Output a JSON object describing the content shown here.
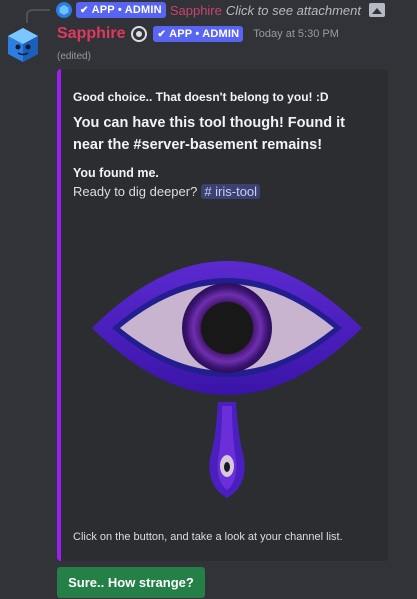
{
  "reply": {
    "badge_label": "APP • ADMIN",
    "author": "Sapphire",
    "text": "Click to see attachment",
    "icon": "image-icon"
  },
  "message": {
    "author": "Sapphire",
    "badge_label": "APP • ADMIN",
    "timestamp": "Today at 5:30 PM",
    "edited": "(edited)",
    "author_color": "#e0395e"
  },
  "embed": {
    "accent_color": "#9b1ff2",
    "line1": "Good choice.. That doesn't belong to you! :D",
    "line2": "You can have this tool though! Found it near the #server-basement remains!",
    "line3": "You found me.",
    "line4_prefix": "Ready to dig deeper?",
    "channel_mention": "# iris-tool",
    "footer": "Click on the button, and take a look at your channel list."
  },
  "button": {
    "label": "Sure.. How strange?",
    "color": "#248046"
  }
}
